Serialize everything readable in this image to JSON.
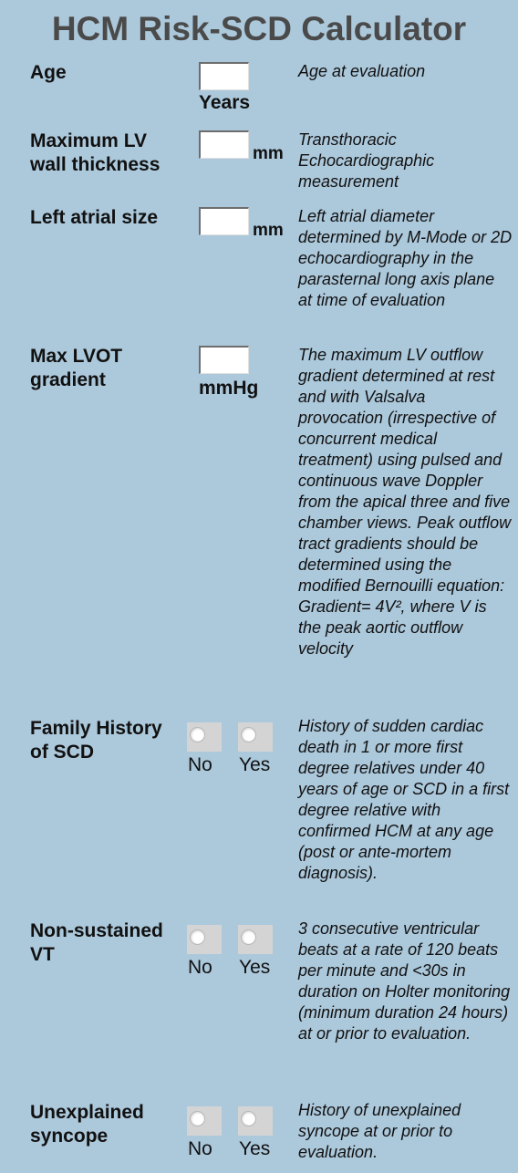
{
  "title": "HCM Risk-SCD Calculator",
  "fields": {
    "age": {
      "label": "Age",
      "value": "",
      "unit": "Years",
      "description": "Age at evaluation"
    },
    "max_lv_wall": {
      "label": "Maximum LV wall thickness",
      "value": "",
      "unit": "mm",
      "description": "Transthoracic Echocardiographic measurement"
    },
    "left_atrial": {
      "label": "Left atrial size",
      "value": "",
      "unit": "mm",
      "description": "Left atrial diameter determined by M-Mode or 2D echocardiography in the parasternal long axis plane at time of evaluation"
    },
    "max_lvot": {
      "label": "Max LVOT gradient",
      "value": "",
      "unit": "mmHg",
      "description": "The maximum LV outflow gradient determined at rest and with Valsalva provocation (irrespective of concurrent medical treatment) using pulsed and continuous wave Doppler from the apical three and five chamber views. Peak outflow tract gradients should be determined using the modified Bernouilli equation: Gradient= 4V², where V is the peak aortic outflow velocity"
    },
    "family_history": {
      "label": "Family History of SCD",
      "no_label": "No",
      "yes_label": "Yes",
      "selected": null,
      "description": "History of sudden cardiac death in 1 or more first degree relatives under 40 years of age or SCD in a first degree relative with confirmed HCM at any age (post or ante-mortem diagnosis)."
    },
    "nsvt": {
      "label": "Non-sustained VT",
      "no_label": "No",
      "yes_label": "Yes",
      "selected": null,
      "description": "3 consecutive ventricular beats at a rate of 120 beats per minute and <30s in duration on Holter monitoring (minimum duration 24 hours) at or prior to evaluation."
    },
    "syncope": {
      "label": "Unexplained syncope",
      "no_label": "No",
      "yes_label": "Yes",
      "selected": null,
      "description": "History of unexplained syncope at or prior to evaluation."
    }
  }
}
